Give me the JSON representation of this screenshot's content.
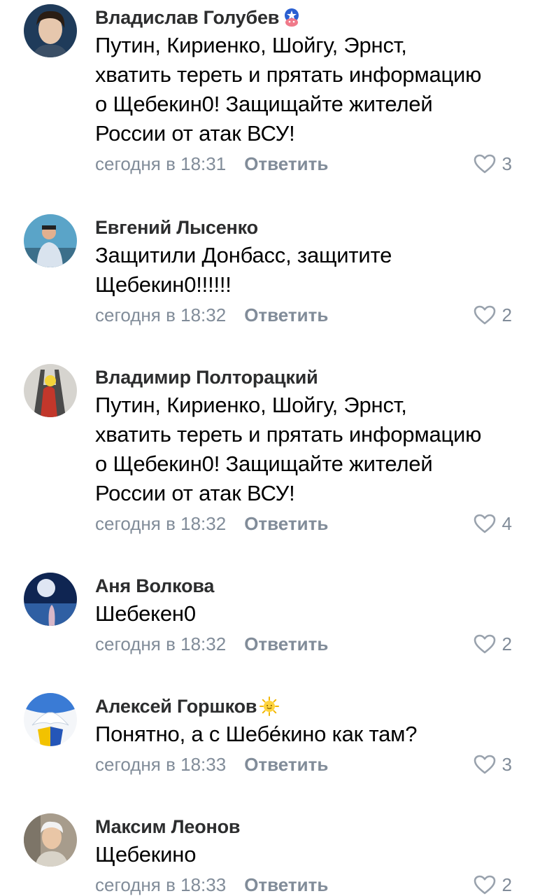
{
  "comments": [
    {
      "author": "Владислав Голубев",
      "badge": "captain-shield-icon",
      "text": "Путин, Кириенко, Шойгу, Эрнст,\nхватить тереть и прятать информацию\nо Щебекин0! Защищайте жителей\nРоссии от атак ВСУ!",
      "time": "сегодня в 18:31",
      "reply_label": "Ответить",
      "likes": "3"
    },
    {
      "author": "Евгений Лысенко",
      "badge": "",
      "text": "Защитили Донбасс, защитите\nЩебекин0!!!!!!",
      "time": "сегодня в 18:32",
      "reply_label": "Ответить",
      "likes": "2"
    },
    {
      "author": "Владимир Полторацкий",
      "badge": "",
      "text": "Путин, Кириенко, Шойгу, Эрнст,\nхватить тереть и прятать информацию\nо Щебекин0! Защищайте жителей\nРоссии от атак ВСУ!",
      "time": "сегодня в 18:32",
      "reply_label": "Ответить",
      "likes": "4"
    },
    {
      "author": "Аня Волкова",
      "badge": "",
      "text": "Шебекен0",
      "time": "сегодня в 18:32",
      "reply_label": "Ответить",
      "likes": "2"
    },
    {
      "author": "Алексей Горшков",
      "badge": "sun-icon",
      "text": "Понятно, а с Шебе́кино как там?",
      "time": "сегодня в 18:33",
      "reply_label": "Ответить",
      "likes": "3"
    },
    {
      "author": "Максим Леонов",
      "badge": "",
      "text": "Щебекино",
      "time": "сегодня в 18:33",
      "reply_label": "Ответить",
      "likes": "2"
    }
  ],
  "colors": {
    "author": "#2c2d2e",
    "meta": "#818c99",
    "text": "#000000"
  }
}
